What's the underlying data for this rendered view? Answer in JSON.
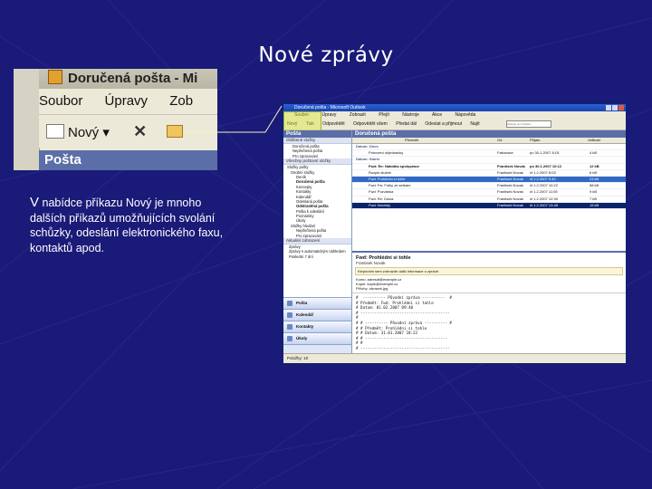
{
  "slide": {
    "title": "Nové zprávy",
    "caption_initial": "V",
    "caption_rest": " nabídce příkazu Nový je mnoho dalších příkazů umožňujících svolání schůzky, odeslání elektronického faxu, kontaktů apod."
  },
  "zoom": {
    "window_title": "Doručená pošta - Mi",
    "menu": [
      "Soubor",
      "Úpravy",
      "Zob"
    ],
    "new_button": "Nový",
    "section_header": "Pošta"
  },
  "outlook": {
    "window_title": "Doručená pošta - Microsoft Outlook",
    "menu": [
      "Soubor",
      "Úpravy",
      "Zobrazit",
      "Přejít",
      "Nástroje",
      "Akce",
      "Nápověda"
    ],
    "toolbar": [
      "Nový",
      "Tisk",
      "Odpovědět",
      "Odpovědět všem",
      "Předat dál",
      "Odeslat a přijmout",
      "Najít"
    ],
    "search_placeholder": "Zadejte text hledání",
    "nav": {
      "header": "Pošta",
      "favorites": "Oblíbené složky",
      "folders_label": "Všechny poštovní složky",
      "tree": [
        "Doručená pošta",
        "Nepřečtená pošta",
        "Pro zpracování",
        "Složky pošty",
        "Osobní složky",
        "Deník",
        "Doručená pošta",
        "Koncepty",
        "Kontakty",
        "Kalendář",
        "Odeslaná pošta",
        "Odstraněná pošta",
        "Pošta k odeslání",
        "Poznámky",
        "Úkoly",
        "Složky hledání",
        "Nepřečtená pošta",
        "Pro zpracování"
      ],
      "views_label": "Aktuální zobrazení",
      "views": [
        "Zprávy",
        "Zprávy s automatickým náhledem",
        "Poslední 7 dní"
      ],
      "buttons": [
        "Pošta",
        "Kalendář",
        "Kontakty",
        "Úkoly"
      ]
    },
    "list": {
      "header": "Doručená pošta",
      "columns": [
        "Od",
        "Předmět",
        "Přijato",
        "Velikost"
      ],
      "groups": [
        "Datum: Dnes",
        "Datum: Starší"
      ],
      "rows": [
        [
          "Fakturace",
          "Potvrzení objednávky",
          "po 30.1.2007 8:15",
          "4 kB"
        ],
        [
          "Frantisek Novak",
          "Fwd: Re: Nabídka spolupráce",
          "po 30.1.2007 10:12",
          "12 kB"
        ],
        [
          "Frantisek Novak",
          "Rozpis služeb",
          "čt 1.2.2007 8:03",
          "6 kB"
        ],
        [
          "Frantisek Novak",
          "Fwd: Prohlédni si tohle",
          "čt 1.2.2007 9:40",
          "23 kB"
        ],
        [
          "Frantisek Novak",
          "Fwd: Fw: Fotky ze setkání",
          "čt 1.2.2007 10:22",
          "58 kB"
        ],
        [
          "Frantisek Novak",
          "Fwd: Pozvánka",
          "čt 1.2.2007 11:05",
          "9 kB"
        ],
        [
          "Frantisek Novak",
          "Fwd: Re: Dotaz",
          "čt 1.2.2007 12:30",
          "7 kB"
        ],
        [
          "Frantisek Novak",
          "Fwd: Novinky",
          "čt 1.2.2007 13:48",
          "15 kB"
        ]
      ]
    },
    "preview": {
      "subject": "Fwd: Prohlédni si tohle",
      "from": "Frantisek Novak",
      "info": "Klepnutím sem zobrazíte další informace o zprávě.",
      "fields": [
        "Komu: adresat@example.cz",
        "Kopie: kopie@example.cz",
        "Přílohy: obrazek.jpg"
      ],
      "body": "#  ---------- Původní zpráva ----------  #\n# Předmět: Fwd: Prohlédni si tohle\n# Datum: 01.02.2007 09:40\n# ---------------------------------------\n#\n# # ---------- Původní zpráva ---------- #\n# # Předmět: Prohlédni si tohle\n# # Datum: 31.01.2007 18:22\n# # ------------------------------------\n# #\n# ---------------------------------------"
    },
    "statusbar": "Položky: 10"
  }
}
